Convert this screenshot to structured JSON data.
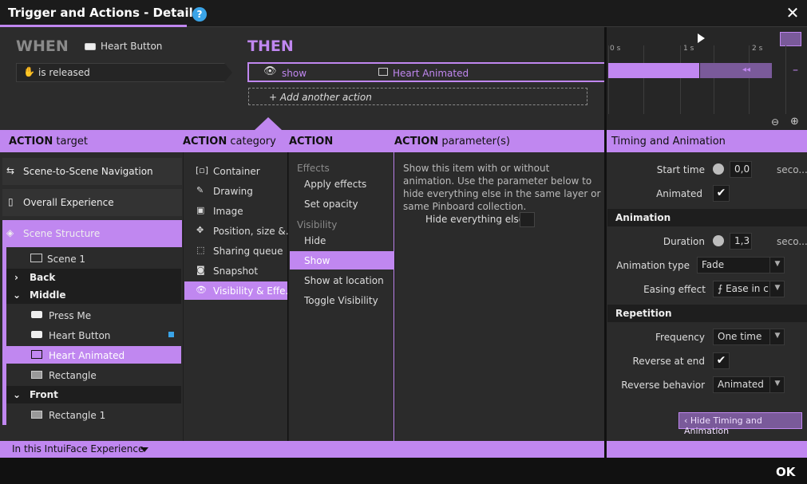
{
  "window": {
    "title": "Trigger and Actions - Details",
    "help": "?",
    "close": "✕"
  },
  "when": {
    "label": "WHEN",
    "target": "Heart Button",
    "trigger": "is released"
  },
  "then": {
    "label": "THEN",
    "action_verb": "show",
    "action_target": "Heart Animated",
    "add_action": "+ Add another action"
  },
  "timeline": {
    "ticks": [
      "0 s",
      "1 s",
      "2 s"
    ],
    "minus": "–",
    "rewind": "◂◂"
  },
  "headers": {
    "target": {
      "bold": "ACTION",
      "rest": "target"
    },
    "category": {
      "bold": "ACTION",
      "rest": "category"
    },
    "action": {
      "bold": "ACTION",
      "rest": ""
    },
    "parameters": {
      "bold": "ACTION",
      "rest": "parameter(s)"
    },
    "timing": "Timing and Animation"
  },
  "targets": {
    "nav": [
      "Scene-to-Scene Navigation",
      "Overall Experience",
      "Scene Structure"
    ],
    "tree": [
      {
        "label": "Scene 1"
      },
      {
        "label": "Back"
      },
      {
        "label": "Middle"
      },
      {
        "label": "Press Me"
      },
      {
        "label": "Heart Button"
      },
      {
        "label": "Heart Animated"
      },
      {
        "label": "Rectangle"
      },
      {
        "label": "Front"
      },
      {
        "label": "Rectangle 1"
      }
    ]
  },
  "categories": [
    "Container",
    "Drawing",
    "Image",
    "Position, size &...",
    "Sharing queue",
    "Snapshot",
    "Visibility & Effe..."
  ],
  "actions": {
    "group1": "Effects",
    "items1": [
      "Apply effects",
      "Set opacity"
    ],
    "group2": "Visibility",
    "items2": [
      "Hide",
      "Show",
      "Show at location",
      "Toggle Visibility"
    ]
  },
  "parameters": {
    "description": "Show this item with or without animation. Use the parameter below to hide everything else in the same layer or same Pinboard collection.",
    "hide_else": "Hide everything else"
  },
  "timing": {
    "start_time_label": "Start time",
    "start_time_value": "0,0",
    "start_time_unit": "seco...",
    "animated_label": "Animated",
    "animation_section": "Animation",
    "duration_label": "Duration",
    "duration_value": "1,3",
    "duration_unit": "seco...",
    "animation_type_label": "Animation type",
    "animation_type_value": "Fade",
    "easing_label": "Easing effect",
    "easing_value": "Ease in c",
    "repetition_section": "Repetition",
    "frequency_label": "Frequency",
    "frequency_value": "One time",
    "reverse_end_label": "Reverse at end",
    "reverse_behavior_label": "Reverse behavior",
    "reverse_behavior_value": "Animated",
    "hide_button": "Hide Timing and Animation"
  },
  "footer": {
    "scope": "In this IntuiFace Experience",
    "ok": "OK"
  },
  "colors": {
    "accent": "#c087f0",
    "background": "#2b2b2b",
    "help": "#3aa4e8"
  }
}
